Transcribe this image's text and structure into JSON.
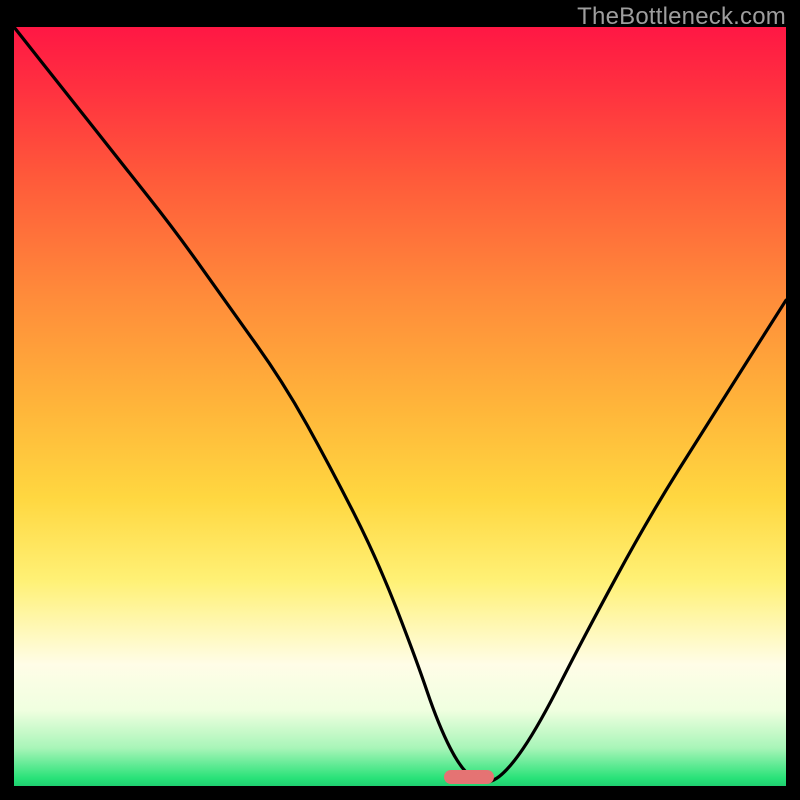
{
  "watermark": "TheBottleneck.com",
  "colors": {
    "frame_bg_top": "#ff1744",
    "frame_bg_bottom": "#1fce70",
    "page_bg": "#000000",
    "watermark": "#9e9e9e",
    "curve": "#000000",
    "pill": "#e57373"
  },
  "chart_data": {
    "type": "line",
    "title": "",
    "xlabel": "",
    "ylabel": "",
    "xlim": [
      0,
      100
    ],
    "ylim": [
      0,
      100
    ],
    "grid": false,
    "legend": false,
    "annotations": [
      {
        "type": "pill-marker",
        "x": 59,
        "y": 0
      }
    ],
    "series": [
      {
        "name": "bottleneck-curve",
        "x": [
          0,
          7,
          14,
          21,
          28,
          35,
          41,
          47,
          52,
          55,
          58,
          61,
          64,
          68,
          74,
          82,
          90,
          100
        ],
        "y": [
          100,
          91,
          82,
          73,
          63,
          53,
          42,
          30,
          17,
          8,
          2,
          0,
          2,
          8,
          20,
          35,
          48,
          64
        ]
      }
    ]
  }
}
